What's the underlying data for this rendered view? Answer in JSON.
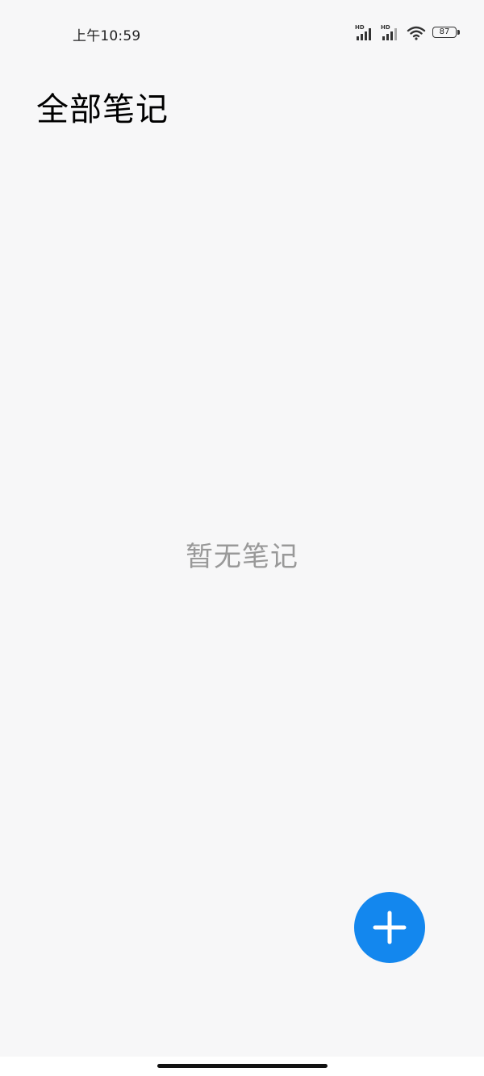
{
  "status_bar": {
    "time": "上午10:59",
    "signal_1_label": "HD",
    "signal_2_label": "HD",
    "battery_level": "87"
  },
  "header": {
    "title": "全部笔记"
  },
  "main": {
    "empty_message": "暂无笔记"
  },
  "fab": {
    "icon": "plus-icon",
    "color": "#1387ee"
  },
  "colors": {
    "background": "#f7f7f8",
    "accent": "#1387ee",
    "empty_text": "#999999"
  }
}
